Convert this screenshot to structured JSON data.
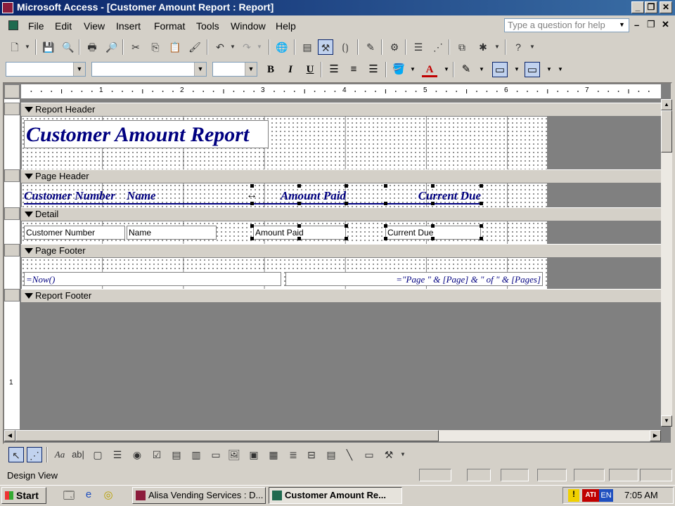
{
  "window": {
    "title": "Microsoft Access - [Customer Amount Report : Report]"
  },
  "menu": {
    "items": [
      "File",
      "Edit",
      "View",
      "Insert",
      "Format",
      "Tools",
      "Window",
      "Help"
    ],
    "ask_placeholder": "Type a question for help"
  },
  "formatting": {
    "bold": "B",
    "italic": "I",
    "underline": "U"
  },
  "ruler": {
    "marks": [
      "1",
      "2",
      "3",
      "4",
      "5",
      "6",
      "7"
    ]
  },
  "vruler": {
    "mark": "1"
  },
  "bands": {
    "report_header": "Report Header",
    "page_header": "Page Header",
    "detail": "Detail",
    "page_footer": "Page Footer",
    "report_footer": "Report Footer"
  },
  "report": {
    "title_label": "Customer Amount Report",
    "page_header_labels": {
      "customer_number": "Customer Number",
      "name": "Name",
      "amount_paid": "Amount Paid",
      "current_due": "Current Due"
    },
    "detail_fields": {
      "customer_number": "Customer Number",
      "name": "Name",
      "amount_paid": "Amount Paid",
      "current_due": "Current Due"
    },
    "page_footer": {
      "now": "=Now()",
      "page_expr": "=\"Page \" & [Page] & \" of \" & [Pages]"
    }
  },
  "toolbox": {
    "label_tool": "Aa",
    "textbox_tool": "ab|"
  },
  "status": {
    "text": "Design View"
  },
  "taskbar": {
    "start": "Start",
    "tasks": [
      "Alisa Vending Services : D...",
      "Customer Amount Re..."
    ],
    "tray_lang": "EN",
    "tray_ati": "ATI",
    "clock": "7:05 AM"
  },
  "colors": {
    "titlebar": "#0a246a",
    "label_text": "#000080",
    "workspace": "#808080"
  }
}
